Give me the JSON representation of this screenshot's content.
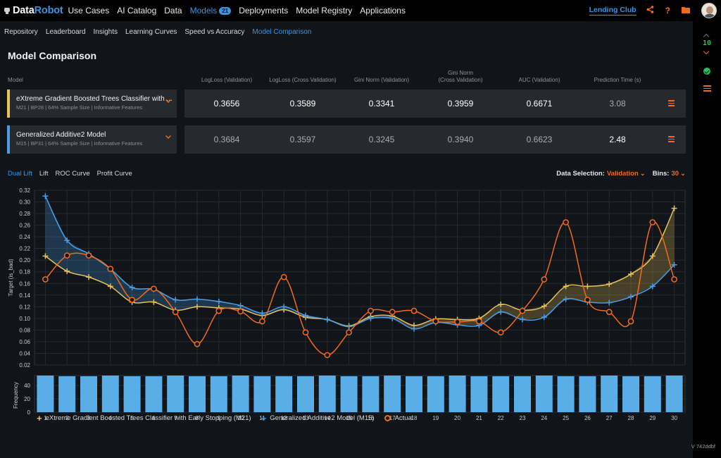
{
  "topbar": {
    "logo_data": "Data",
    "logo_robot": "Robot",
    "nav": [
      {
        "label": "Use Cases"
      },
      {
        "label": "AI Catalog"
      },
      {
        "label": "Data"
      },
      {
        "label": "Models",
        "badge": "21",
        "active": true
      },
      {
        "label": "Deployments"
      },
      {
        "label": "Model Registry"
      },
      {
        "label": "Applications"
      }
    ],
    "project": "Lending Club",
    "icons": [
      "share-icon",
      "help-icon",
      "folder-icon",
      "avatar"
    ]
  },
  "subnav": [
    "Repository",
    "Leaderboard",
    "Insights",
    "Learning Curves",
    "Speed vs Accuracy",
    "Model Comparison"
  ],
  "page_title": "Model Comparison",
  "columns": {
    "model": "Model",
    "metrics": [
      "LogLoss (Validation)",
      "LogLoss (Cross Validation)",
      "Gini Norm (Validation)",
      "Gini Norm\n(Cross Validation)",
      "AUC (Validation)",
      "Prediction Time (s)"
    ]
  },
  "models": [
    {
      "name": "eXtreme Gradient Boosted Trees Classifier with ...",
      "meta": "M21 | BP28 | 64% Sample Size | Informative Features",
      "color": "#e8c25a",
      "metrics": [
        "0.3656",
        "0.3589",
        "0.3341",
        "0.3959",
        "0.6671",
        "3.08"
      ],
      "best": [
        true,
        true,
        true,
        true,
        true,
        false
      ]
    },
    {
      "name": "Generalized Additive2 Model",
      "meta": "M15 | BP31 | 64% Sample Size | Informative Features",
      "color": "#4a9ee8",
      "metrics": [
        "0.3684",
        "0.3597",
        "0.3245",
        "0.3940",
        "0.6623",
        "2.48"
      ],
      "best": [
        false,
        false,
        false,
        false,
        false,
        true
      ]
    }
  ],
  "tabs": [
    "Dual Lift",
    "Lift",
    "ROC Curve",
    "Profit Curve"
  ],
  "controls": {
    "data_selection_label": "Data Selection:",
    "data_selection_value": "Validation",
    "bins_label": "Bins:",
    "bins_value": "30"
  },
  "rail": {
    "count": "10"
  },
  "version": "V 742ddbf",
  "chart_data": {
    "type": "line",
    "title": "Dual Lift",
    "xlabel": "",
    "ylabel": "Target (is_bad)",
    "ylim": [
      0.02,
      0.32
    ],
    "yticks": [
      "0.02",
      "0.04",
      "0.06",
      "0.08",
      "0.10",
      "0.12",
      "0.14",
      "0.16",
      "0.18",
      "0.20",
      "0.22",
      "0.24",
      "0.26",
      "0.28",
      "0.30",
      "0.32"
    ],
    "x": [
      1,
      2,
      3,
      4,
      5,
      6,
      7,
      8,
      9,
      10,
      11,
      12,
      13,
      14,
      15,
      16,
      17,
      18,
      19,
      20,
      21,
      22,
      23,
      24,
      25,
      26,
      27,
      28,
      29,
      30
    ],
    "grid": true,
    "legend_position": "bottom-left",
    "series": [
      {
        "name": "eXtreme Gradient Boosted Trees Classifier with Early Stopping (M21)",
        "color": "#e8c25a",
        "marker": "plus",
        "values": [
          0.207,
          0.181,
          0.171,
          0.155,
          0.128,
          0.128,
          0.114,
          0.12,
          0.118,
          0.116,
          0.105,
          0.115,
          0.102,
          0.098,
          0.087,
          0.103,
          0.104,
          0.088,
          0.099,
          0.098,
          0.1,
          0.124,
          0.114,
          0.121,
          0.155,
          0.155,
          0.159,
          0.176,
          0.207,
          0.289
        ]
      },
      {
        "name": "Generalized Additive2 Model (M15)",
        "color": "#4a9ee8",
        "marker": "plus",
        "values": [
          0.31,
          0.234,
          0.211,
          0.185,
          0.153,
          0.15,
          0.132,
          0.133,
          0.129,
          0.122,
          0.109,
          0.12,
          0.105,
          0.098,
          0.086,
          0.1,
          0.1,
          0.082,
          0.093,
          0.089,
          0.088,
          0.111,
          0.098,
          0.102,
          0.133,
          0.128,
          0.127,
          0.137,
          0.155,
          0.192
        ]
      },
      {
        "name": "Actual",
        "color": "#f26b1d",
        "marker": "circle",
        "values": [
          0.167,
          0.208,
          0.208,
          0.185,
          0.132,
          0.151,
          0.111,
          0.056,
          0.113,
          0.112,
          0.095,
          0.171,
          0.076,
          0.037,
          0.076,
          0.113,
          0.111,
          0.113,
          0.095,
          0.094,
          0.095,
          0.076,
          0.113,
          0.167,
          0.265,
          0.132,
          0.111,
          0.095,
          0.265,
          0.167
        ]
      }
    ],
    "frequency": {
      "ylabel": "Frequency",
      "ylim": [
        0,
        55
      ],
      "yticks": [
        "0",
        "20",
        "40"
      ],
      "color": "#5aaee8",
      "values": [
        55,
        54,
        54,
        55,
        54,
        54,
        55,
        54,
        54,
        55,
        54,
        54,
        54,
        55,
        54,
        54,
        55,
        54,
        54,
        55,
        54,
        54,
        54,
        55,
        54,
        54,
        55,
        54,
        54,
        55
      ]
    }
  }
}
